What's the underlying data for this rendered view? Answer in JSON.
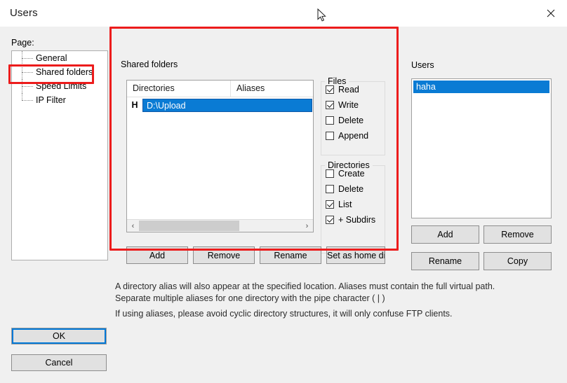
{
  "window": {
    "title": "Users",
    "close_icon": "close-icon"
  },
  "sidebar": {
    "label": "Page:",
    "items": [
      {
        "label": "General",
        "selected": false
      },
      {
        "label": "Shared folders",
        "selected": true
      },
      {
        "label": "Speed Limits",
        "selected": false
      },
      {
        "label": "IP Filter",
        "selected": false
      }
    ]
  },
  "shared_folders": {
    "group_title": "Shared folders",
    "columns": [
      "Directories",
      "Aliases"
    ],
    "rows": [
      {
        "home_flag": "H",
        "directory": "D:\\Upload",
        "alias": "",
        "selected": true
      }
    ],
    "scroll": {
      "left_arrow": "‹",
      "right_arrow": "›",
      "thumb_pct": 62
    },
    "buttons": {
      "add": "Add",
      "remove": "Remove",
      "rename": "Rename",
      "set_home": "Set as home dir"
    },
    "files_group": {
      "title": "Files",
      "items": [
        {
          "label": "Read",
          "checked": true
        },
        {
          "label": "Write",
          "checked": true
        },
        {
          "label": "Delete",
          "checked": false
        },
        {
          "label": "Append",
          "checked": false
        }
      ]
    },
    "directories_group": {
      "title": "Directories",
      "items": [
        {
          "label": "Create",
          "checked": false
        },
        {
          "label": "Delete",
          "checked": false
        },
        {
          "label": "List",
          "checked": true
        },
        {
          "label": "+ Subdirs",
          "checked": true
        }
      ]
    }
  },
  "users_panel": {
    "group_title": "Users",
    "list": [
      {
        "name": "haha",
        "selected": true
      }
    ],
    "buttons": {
      "add": "Add",
      "remove": "Remove",
      "rename": "Rename",
      "copy": "Copy"
    }
  },
  "hints": {
    "line1": "A directory alias will also appear at the specified location. Aliases must contain the full virtual path. Separate multiple aliases for one directory with the pipe character ( | )",
    "line2": "If using aliases, please avoid cyclic directory structures, it will only confuse FTP clients."
  },
  "dialog_buttons": {
    "ok": "OK",
    "cancel": "Cancel"
  },
  "annotations": {
    "color": "#ec1c1c",
    "boxes": [
      "sidebar-shared-folders",
      "shared-folders-panel"
    ]
  },
  "theme": {
    "selection_blue": "#0a7bd4",
    "focus_blue": "#0078d7",
    "dialog_bg": "#f0f0f0",
    "button_bg": "#e1e1e1"
  }
}
